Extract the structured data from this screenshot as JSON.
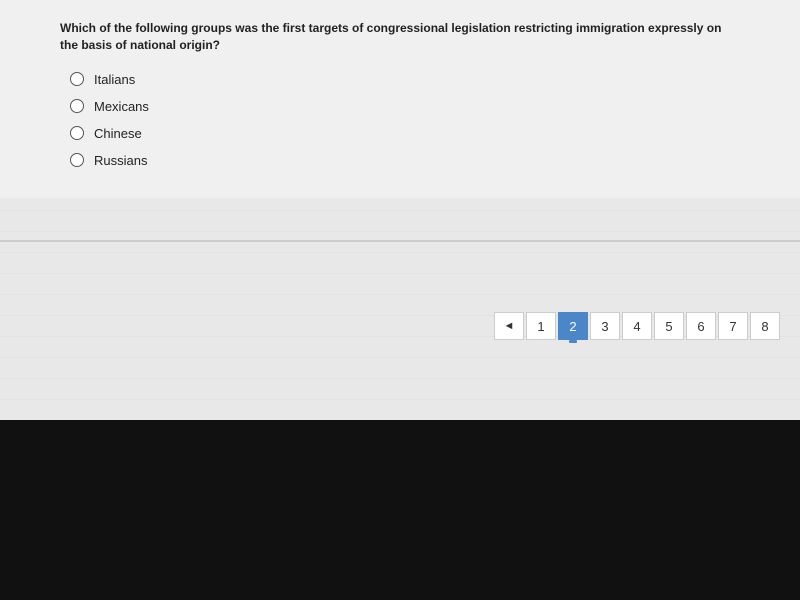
{
  "question": {
    "text": "Which of the following groups was the first targets of congressional legislation restricting immigration expressly on the basis of national origin?"
  },
  "options": [
    {
      "id": "italians",
      "label": "Italians"
    },
    {
      "id": "mexicans",
      "label": "Mexicans"
    },
    {
      "id": "chinese",
      "label": "Chinese"
    },
    {
      "id": "russians",
      "label": "Russians"
    }
  ],
  "pagination": {
    "prev_label": "◄",
    "pages": [
      "1",
      "2",
      "3",
      "4",
      "5",
      "6",
      "7",
      "8"
    ],
    "active_page": "2"
  }
}
